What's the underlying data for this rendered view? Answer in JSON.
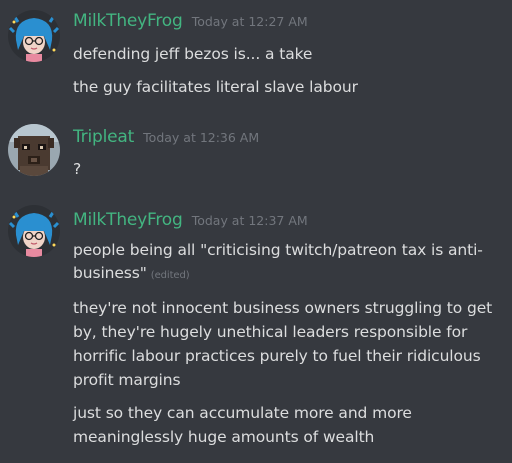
{
  "messages": [
    {
      "username": "MilkTheyFrog",
      "timestamp": "Today at 12:27 AM",
      "lines": [
        "defending jeff bezos is... a take",
        "the guy facilitates literal slave labour"
      ]
    },
    {
      "username": "Tripleat",
      "timestamp": "Today at 12:36 AM",
      "lines": [
        "?"
      ]
    },
    {
      "username": "MilkTheyFrog",
      "timestamp": "Today at 12:37 AM",
      "lines": [
        "people being all \"criticising twitch/patreon tax is anti-",
        "business\"",
        "they're not innocent business owners struggling to get",
        "by, they're hugely unethical leaders responsible for",
        "horrific labour practices purely to fuel their ridiculous",
        "profit margins",
        "just so they can accumulate more and more",
        "meaninglessly huge amounts of wealth"
      ],
      "edited_label": "(edited)"
    }
  ],
  "colors": {
    "background": "#36393f",
    "username": "#43b581",
    "timestamp": "#72767d",
    "text": "#dcddde"
  },
  "icons": [
    "milktheyfrog-avatar",
    "tripleat-avatar"
  ]
}
